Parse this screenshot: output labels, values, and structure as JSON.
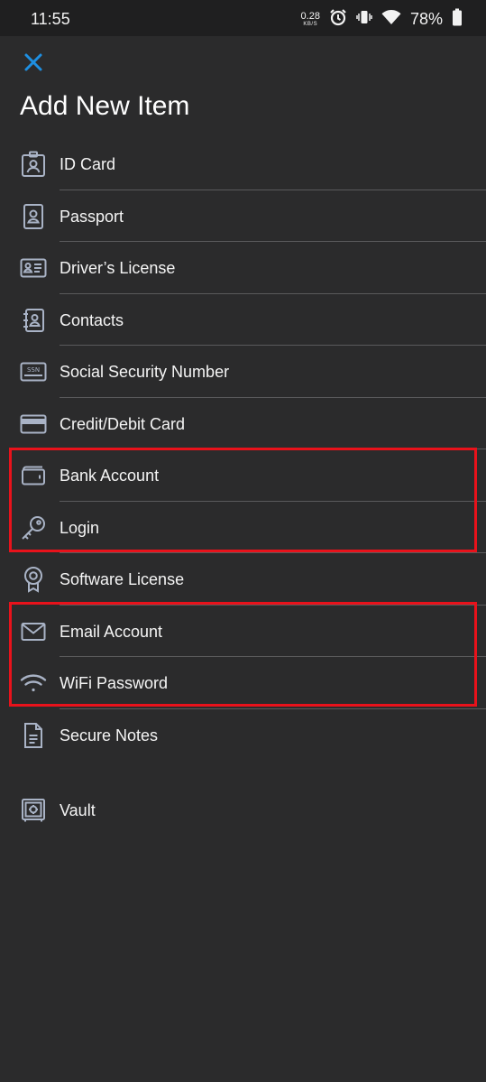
{
  "status_bar": {
    "time": "11:55",
    "net_speed_value": "0.28",
    "net_speed_unit": "KB/S",
    "battery_percent": "78%"
  },
  "header": {
    "close_icon": "close-icon",
    "title": "Add New Item"
  },
  "colors": {
    "background": "#2b2b2c",
    "accent": "#1e8fe1",
    "icon": "#a9b3c6",
    "highlight": "#e8121b"
  },
  "items": [
    {
      "label": "ID Card",
      "icon": "id-card-icon"
    },
    {
      "label": "Passport",
      "icon": "passport-icon"
    },
    {
      "label": "Driver’s License",
      "icon": "drivers-license-icon"
    },
    {
      "label": "Contacts",
      "icon": "contacts-icon"
    },
    {
      "label": "Social Security Number",
      "icon": "ssn-card-icon",
      "icon_text": "SSN"
    },
    {
      "label": "Credit/Debit Card",
      "icon": "credit-card-icon"
    },
    {
      "label": "Bank Account",
      "icon": "wallet-icon"
    },
    {
      "label": "Login",
      "icon": "key-icon"
    },
    {
      "label": "Software License",
      "icon": "award-badge-icon"
    },
    {
      "label": "Email Account",
      "icon": "envelope-icon"
    },
    {
      "label": "WiFi Password",
      "icon": "wifi-icon"
    },
    {
      "label": "Secure Notes",
      "icon": "document-icon"
    },
    {
      "label": "Vault",
      "icon": "vault-icon"
    }
  ]
}
